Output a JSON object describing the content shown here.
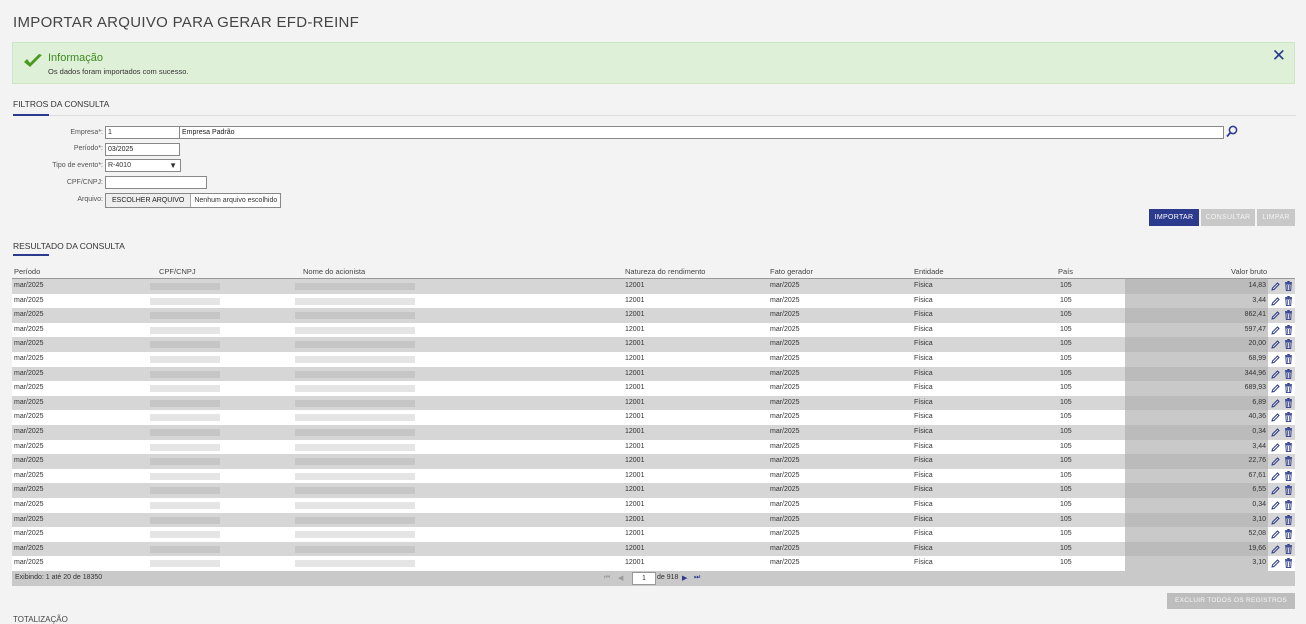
{
  "page": {
    "title": "IMPORTAR ARQUIVO PARA GERAR EFD-REINF"
  },
  "alert": {
    "title": "Informação",
    "message": "Os dados foram importados com sucesso.",
    "close_label": "✕",
    "color": "#3c8a1f"
  },
  "filters": {
    "section_title": "FILTROS DA CONSULTA",
    "empresa_label": "Empresa*:",
    "empresa_code": "1",
    "empresa_name": "Empresa Padrão",
    "periodo_label": "Período*:",
    "periodo_value": "03/2025",
    "tipo_label": "Tipo de evento*:",
    "tipo_value": "R-4010",
    "cpf_label": "CPF/CNPJ:",
    "cpf_value": "",
    "arquivo_label": "Arquivo:",
    "file_button": "ESCOLHER ARQUIVO",
    "file_status": "Nenhum arquivo escolhido"
  },
  "actions": {
    "importar": "IMPORTAR",
    "consultar": "CONSULTAR",
    "limpar": "LIMPAR"
  },
  "results": {
    "section_title": "RESULTADO DA CONSULTA",
    "columns": [
      "Período",
      "CPF/CNPJ",
      "Nome do acionista",
      "Natureza do rendimento",
      "Fato gerador",
      "Entidade",
      "País",
      "Valor bruto"
    ],
    "rows": [
      {
        "periodo": "mar/2025",
        "natureza": "12001",
        "fato": "mar/2025",
        "entidade": "Física",
        "pais": "105",
        "valor": "14,83"
      },
      {
        "periodo": "mar/2025",
        "natureza": "12001",
        "fato": "mar/2025",
        "entidade": "Física",
        "pais": "105",
        "valor": "3,44"
      },
      {
        "periodo": "mar/2025",
        "natureza": "12001",
        "fato": "mar/2025",
        "entidade": "Física",
        "pais": "105",
        "valor": "862,41"
      },
      {
        "periodo": "mar/2025",
        "natureza": "12001",
        "fato": "mar/2025",
        "entidade": "Física",
        "pais": "105",
        "valor": "597,47"
      },
      {
        "periodo": "mar/2025",
        "natureza": "12001",
        "fato": "mar/2025",
        "entidade": "Física",
        "pais": "105",
        "valor": "20,00"
      },
      {
        "periodo": "mar/2025",
        "natureza": "12001",
        "fato": "mar/2025",
        "entidade": "Física",
        "pais": "105",
        "valor": "68,99"
      },
      {
        "periodo": "mar/2025",
        "natureza": "12001",
        "fato": "mar/2025",
        "entidade": "Física",
        "pais": "105",
        "valor": "344,96"
      },
      {
        "periodo": "mar/2025",
        "natureza": "12001",
        "fato": "mar/2025",
        "entidade": "Física",
        "pais": "105",
        "valor": "689,93"
      },
      {
        "periodo": "mar/2025",
        "natureza": "12001",
        "fato": "mar/2025",
        "entidade": "Física",
        "pais": "105",
        "valor": "6,89"
      },
      {
        "periodo": "mar/2025",
        "natureza": "12001",
        "fato": "mar/2025",
        "entidade": "Física",
        "pais": "105",
        "valor": "40,36"
      },
      {
        "periodo": "mar/2025",
        "natureza": "12001",
        "fato": "mar/2025",
        "entidade": "Física",
        "pais": "105",
        "valor": "0,34"
      },
      {
        "periodo": "mar/2025",
        "natureza": "12001",
        "fato": "mar/2025",
        "entidade": "Física",
        "pais": "105",
        "valor": "3,44"
      },
      {
        "periodo": "mar/2025",
        "natureza": "12001",
        "fato": "mar/2025",
        "entidade": "Física",
        "pais": "105",
        "valor": "22,76"
      },
      {
        "periodo": "mar/2025",
        "natureza": "12001",
        "fato": "mar/2025",
        "entidade": "Física",
        "pais": "105",
        "valor": "67,61"
      },
      {
        "periodo": "mar/2025",
        "natureza": "12001",
        "fato": "mar/2025",
        "entidade": "Física",
        "pais": "105",
        "valor": "6,55"
      },
      {
        "periodo": "mar/2025",
        "natureza": "12001",
        "fato": "mar/2025",
        "entidade": "Física",
        "pais": "105",
        "valor": "0,34"
      },
      {
        "periodo": "mar/2025",
        "natureza": "12001",
        "fato": "mar/2025",
        "entidade": "Física",
        "pais": "105",
        "valor": "3,10"
      },
      {
        "periodo": "mar/2025",
        "natureza": "12001",
        "fato": "mar/2025",
        "entidade": "Física",
        "pais": "105",
        "valor": "52,08"
      },
      {
        "periodo": "mar/2025",
        "natureza": "12001",
        "fato": "mar/2025",
        "entidade": "Física",
        "pais": "105",
        "valor": "19,66"
      },
      {
        "periodo": "mar/2025",
        "natureza": "12001",
        "fato": "mar/2025",
        "entidade": "Física",
        "pais": "105",
        "valor": "3,10"
      }
    ],
    "footer_info": "Exibindo: 1 até 20 de 18350",
    "page_current": "1",
    "page_of": "de 918",
    "delete_all": "EXCLUIR TODOS OS REGISTROS"
  },
  "totals": {
    "section_title": "TOTALIZAÇÃO"
  },
  "icons": {
    "search": "search-icon",
    "edit": "pencil-icon",
    "delete": "trash-icon",
    "check": "check-icon",
    "close": "close-icon"
  },
  "colors": {
    "primary": "#2b3a8c",
    "success_bg": "#dff0d8"
  }
}
